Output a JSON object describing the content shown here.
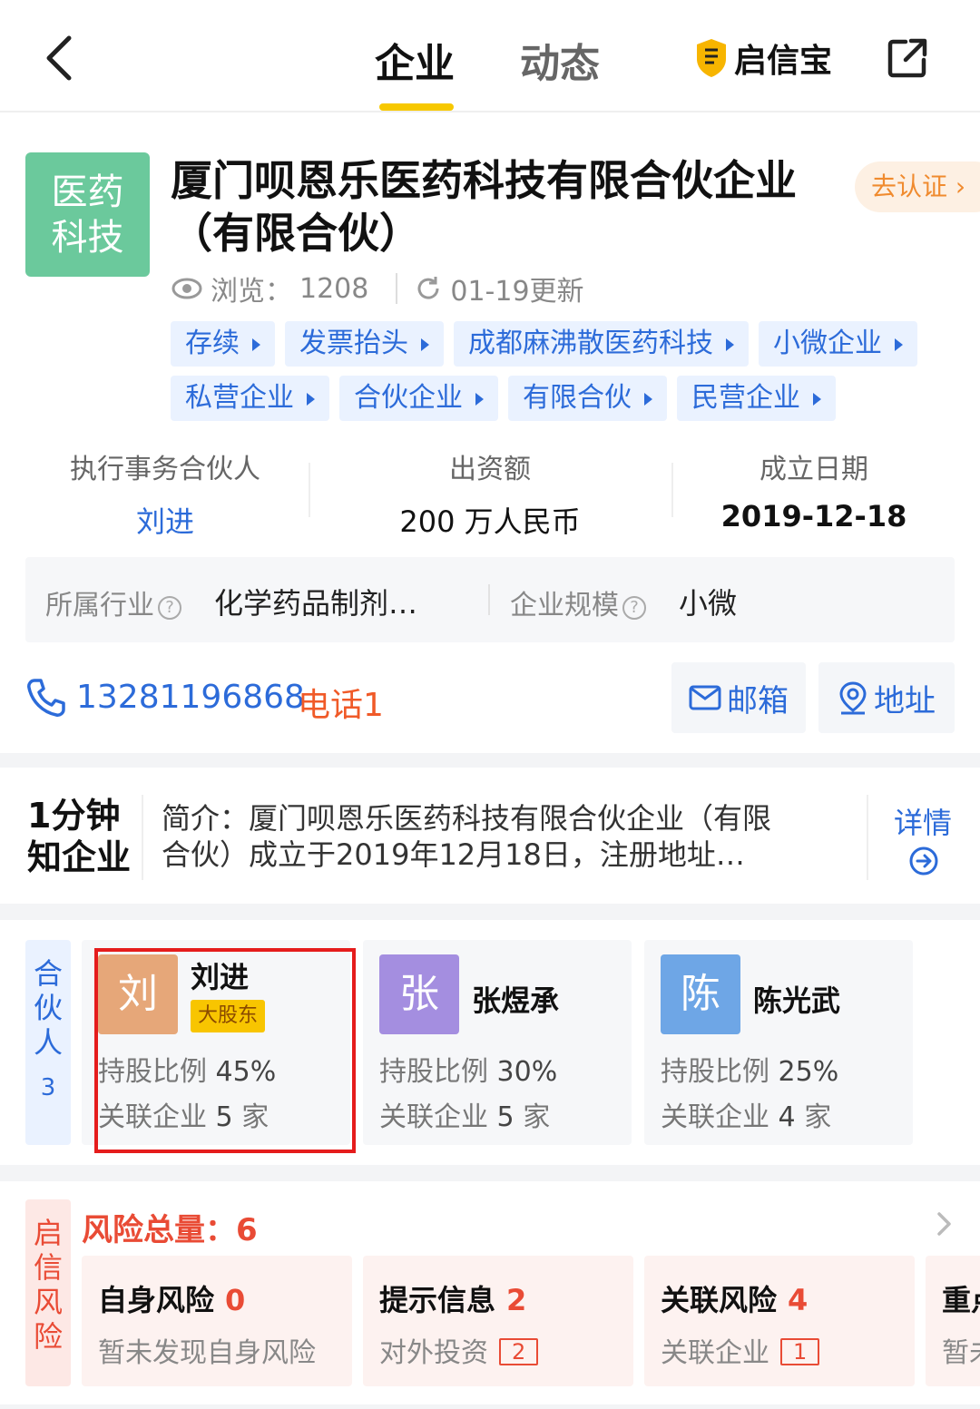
{
  "nav": {
    "tab_company": "企业",
    "tab_dynamic": "动态",
    "brand": "启信宝",
    "accent": "#f7c800"
  },
  "company": {
    "logo_line1": "医药",
    "logo_line2": "科技",
    "name": "厦门呗恩乐医药科技有限合伙企业（有限合伙）",
    "cert_label": "去认证 ›",
    "views_label": "浏览：",
    "views": "1208",
    "updated": "01-19更新",
    "tags_row1": [
      "存续",
      "发票抬头",
      "成都麻沸散医药科技",
      "小微企业"
    ],
    "tags_row2": [
      "私营企业",
      "合伙企业",
      "有限合伙",
      "民营企业"
    ]
  },
  "info": {
    "partner_label": "执行事务合伙人",
    "partner_value": "刘进",
    "capital_label": "出资额",
    "capital_value": "200 万人民币",
    "date_label": "成立日期",
    "date_value": "2019-12-18"
  },
  "industry": {
    "industry_label": "所属行业",
    "industry_value": "化学药品制剂…",
    "scale_label": "企业规模",
    "scale_value": "小微"
  },
  "contact": {
    "phone": "13281196868",
    "phone_count": "电话1",
    "email_label": "邮箱",
    "address_label": "地址"
  },
  "intro": {
    "logo_line1": "1分钟",
    "logo_line2": "知企业",
    "text_line1": "简介：厦门呗恩乐医药科技有限合伙企业（有限",
    "text_line2": "合伙）成立于2019年12月18日，注册地址…",
    "detail_label": "详情"
  },
  "partners": {
    "side_label": [
      "合",
      "伙",
      "人"
    ],
    "count": "3",
    "items": [
      {
        "avatar": "刘",
        "name": "刘进",
        "badge": "大股东",
        "share_label": "持股比例",
        "share": "45%",
        "related_label": "关联企业",
        "related": "5",
        "unit": "家",
        "color": "#e6a779"
      },
      {
        "avatar": "张",
        "name": "张煜承",
        "badge": "",
        "share_label": "持股比例",
        "share": "30%",
        "related_label": "关联企业",
        "related": "5",
        "unit": "家",
        "color": "#a48ee0"
      },
      {
        "avatar": "陈",
        "name": "陈光武",
        "badge": "",
        "share_label": "持股比例",
        "share": "25%",
        "related_label": "关联企业",
        "related": "4",
        "unit": "家",
        "color": "#6ea6e6"
      }
    ]
  },
  "risk": {
    "side_label": [
      "启",
      "信",
      "风",
      "险"
    ],
    "title": "风险总量：6",
    "cards": [
      {
        "title": "自身风险",
        "count": "0",
        "sub": "暂未发现自身风险",
        "sub_count": ""
      },
      {
        "title": "提示信息",
        "count": "2",
        "sub": "对外投资",
        "sub_count": "2"
      },
      {
        "title": "关联风险",
        "count": "4",
        "sub": "关联企业",
        "sub_count": "1"
      },
      {
        "title": "重点",
        "count": "",
        "sub": "暂未",
        "sub_count": ""
      }
    ]
  }
}
